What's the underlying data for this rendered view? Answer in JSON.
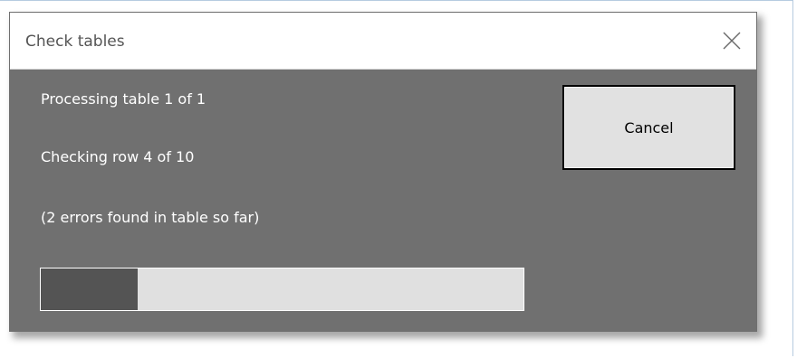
{
  "dialog": {
    "title": "Check tables",
    "lines": {
      "processing": "Processing table 1 of 1",
      "checking": "Checking row 4 of 10",
      "errors": "(2 errors found in table so far)"
    },
    "cancel_label": "Cancel",
    "progress_fraction": 0.2,
    "close_icon": "close-icon"
  },
  "colors": {
    "dialog_background": "#707070",
    "progress_fill": "#545454",
    "progress_track": "#e0e0e0",
    "button_background": "#e1e1e1"
  }
}
